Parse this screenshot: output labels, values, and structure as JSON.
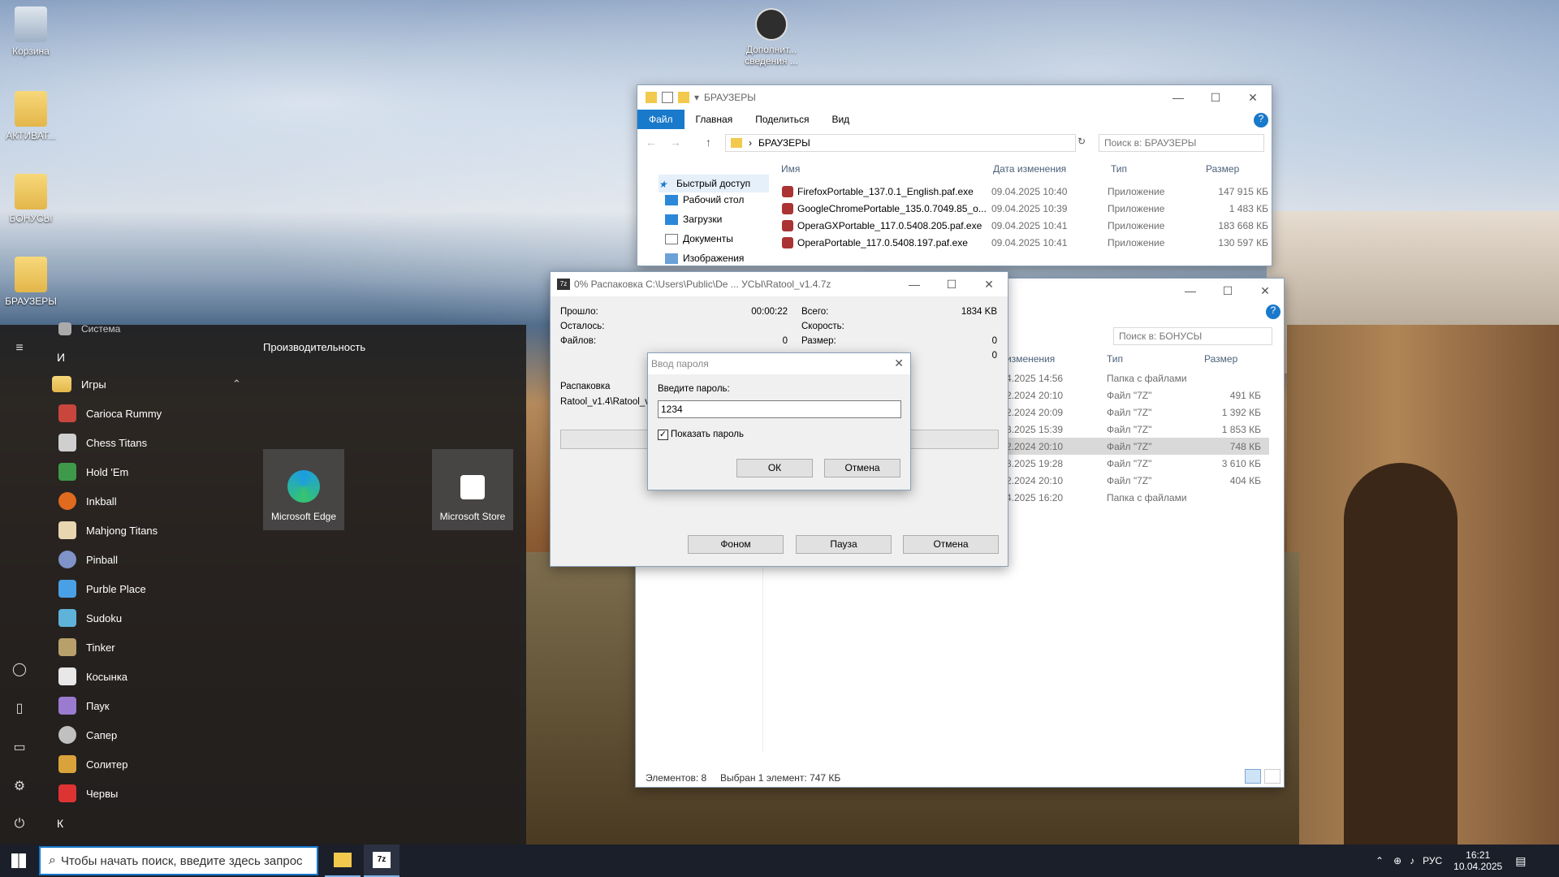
{
  "desktop": {
    "icons": [
      {
        "label": "Корзина"
      },
      {
        "label": "АКТИВАТ..."
      },
      {
        "label": "БОНУСЫ"
      },
      {
        "label": "БРАУЗЕРЫ"
      },
      {
        "label": "Дополнит... сведения ..."
      }
    ]
  },
  "start_menu": {
    "top_item": "Система",
    "letter_i": "И",
    "group_games": "Игры",
    "apps": [
      "Carioca Rummy",
      "Chess Titans",
      "Hold 'Em",
      "Inkball",
      "Mahjong Titans",
      "Pinball",
      "Purble Place",
      "Sudoku",
      "Tinker",
      "Косынка",
      "Паук",
      "Сапер",
      "Солитер",
      "Червы"
    ],
    "letter_k": "К",
    "tiles_header": "Производительность",
    "tile_edge": "Microsoft Edge",
    "tile_store": "Microsoft Store"
  },
  "explorer_browsers": {
    "title": "БРАУЗЕРЫ",
    "ribbon": {
      "file": "Файл",
      "home": "Главная",
      "share": "Поделиться",
      "view": "Вид"
    },
    "address": "БРАУЗЕРЫ",
    "search_placeholder": "Поиск в: БРАУЗЕРЫ",
    "columns": {
      "name": "Имя",
      "date": "Дата изменения",
      "type": "Тип",
      "size": "Размер"
    },
    "nav": [
      "Быстрый доступ",
      "Рабочий стол",
      "Загрузки",
      "Документы",
      "Изображения"
    ],
    "files": [
      {
        "name": "FirefoxPortable_137.0.1_English.paf.exe",
        "date": "09.04.2025 10:40",
        "type": "Приложение",
        "size": "147 915 КБ"
      },
      {
        "name": "GoogleChromePortable_135.0.7049.85_o...",
        "date": "09.04.2025 10:39",
        "type": "Приложение",
        "size": "1 483 КБ"
      },
      {
        "name": "OperaGXPortable_117.0.5408.205.paf.exe",
        "date": "09.04.2025 10:41",
        "type": "Приложение",
        "size": "183 668 КБ"
      },
      {
        "name": "OperaPortable_117.0.5408.197.paf.exe",
        "date": "09.04.2025 10:41",
        "type": "Приложение",
        "size": "130 597 КБ"
      }
    ]
  },
  "explorer_bonus": {
    "search_placeholder": "Поиск в: БОНУСЫ",
    "columns": {
      "date": "изменения",
      "type": "Тип",
      "size": "Размер"
    },
    "files": [
      {
        "date": "4.2025 14:56",
        "type": "Папка с файлами",
        "size": ""
      },
      {
        "date": "2.2024 20:10",
        "type": "Файл \"7Z\"",
        "size": "491 КБ"
      },
      {
        "date": "2.2024 20:09",
        "type": "Файл \"7Z\"",
        "size": "1 392 КБ"
      },
      {
        "date": "3.2025 15:39",
        "type": "Файл \"7Z\"",
        "size": "1 853 КБ"
      },
      {
        "date": "2.2024 20:10",
        "type": "Файл \"7Z\"",
        "size": "748 КБ"
      },
      {
        "date": "3.2025 19:28",
        "type": "Файл \"7Z\"",
        "size": "3 610 КБ"
      },
      {
        "date": "2.2024 20:10",
        "type": "Файл \"7Z\"",
        "size": "404 КБ"
      },
      {
        "date": "4.2025 16:20",
        "type": "Папка с файлами",
        "size": ""
      }
    ],
    "status_items": "Элементов: 8",
    "status_selected": "Выбран 1 элемент: 747 КБ"
  },
  "extract_window": {
    "title": "0% Распаковка C:\\Users\\Public\\De ... УСЫ\\Ratool_v1.4.7z",
    "elapsed_label": "Прошло:",
    "elapsed_value": "00:00:22",
    "remaining_label": "Осталось:",
    "files_label": "Файлов:",
    "files_value": "0",
    "total_label": "Всего:",
    "total_value": "1834 KB",
    "speed_label": "Скорость:",
    "size_label": "Размер:",
    "size_value": "0",
    "extra_value": "0",
    "action_label": "Распаковка",
    "current_file": "Ratool_v1.4\\Ratool_v",
    "btn_background": "Фоном",
    "btn_pause": "Пауза",
    "btn_cancel": "Отмена"
  },
  "password_dialog": {
    "title": "Ввод пароля",
    "prompt": "Введите пароль:",
    "value": "1234",
    "show_password": "Показать пароль",
    "ok": "ОК",
    "cancel": "Отмена"
  },
  "taskbar": {
    "search_placeholder": "Чтобы начать поиск, введите здесь запрос",
    "lang": "РУС",
    "time": "16:21",
    "date": "10.04.2025"
  }
}
